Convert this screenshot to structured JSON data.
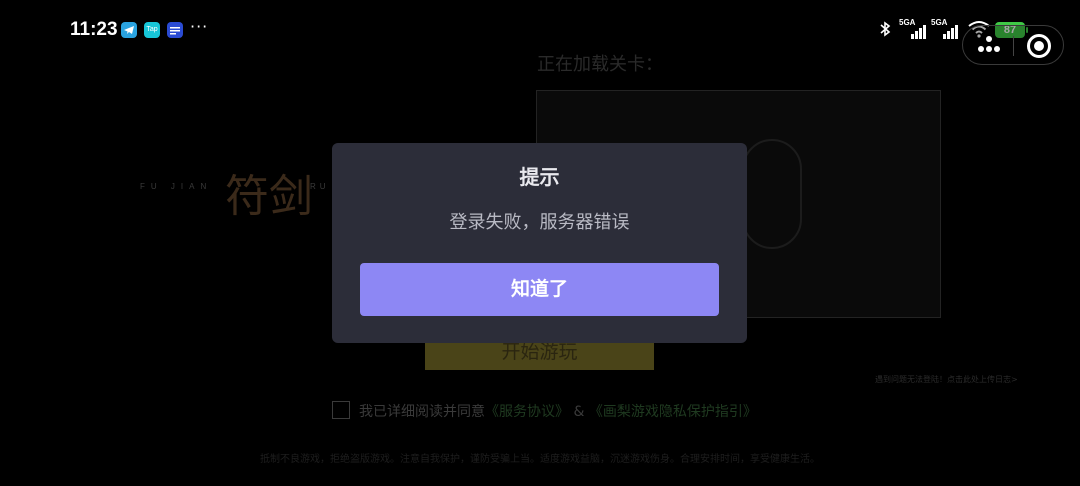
{
  "status_bar": {
    "time": "11:23",
    "app_icons": [
      "telegram-icon",
      "taptap-icon",
      "app-icon"
    ],
    "app_icon_labels": {
      "tap": "Tap"
    },
    "more": "···",
    "signal_1_label": "5GA",
    "signal_2_label": "5GA",
    "battery": "87"
  },
  "game_page": {
    "loading_label": "正在加载关卡：",
    "logo_left": "FU JIAN",
    "logo_calligraphy": "符剑",
    "logo_right": "RU",
    "start_button": "开始游玩",
    "help_link": "遇到问题无法登陆！点击此处上传日志>",
    "agree_prefix": "我已详细阅读并同意",
    "service_agreement": "《服务协议》",
    "ampersand": "&",
    "privacy_guide": "《画梨游戏隐私保护指引》",
    "health_notice": "抵制不良游戏，拒绝盗版游戏。注意自我保护，谨防受骗上当。适度游戏益脑，沉迷游戏伤身。合理安排时间，享受健康生活。"
  },
  "dialog": {
    "title": "提示",
    "message": "登录失败，服务器错误",
    "confirm_label": "知道了"
  },
  "colors": {
    "dialog_bg": "#2c2d39",
    "confirm_button": "#8d87f4",
    "battery": "#3fc946"
  }
}
